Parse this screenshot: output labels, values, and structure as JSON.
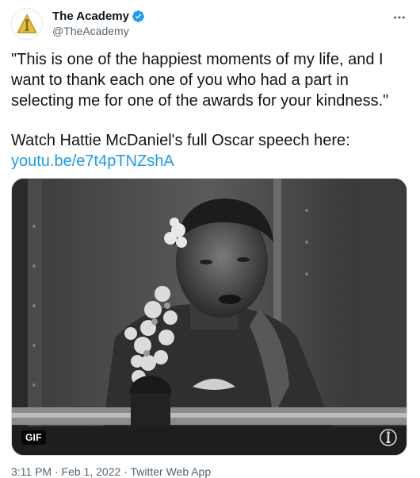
{
  "tweet": {
    "display_name": "The Academy",
    "handle": "@TheAcademy",
    "verified": true,
    "text_line1": "\"This is one of the happiest moments of my life, and I want to thank each one of you who had a part in selecting me for one of the awards for your kindness.\"",
    "text_line2": "Watch Hattie McDaniel's full Oscar speech here:",
    "link": "youtu.be/e7t4pTNZshA",
    "media_badge": "GIF",
    "timestamp": "3:11 PM · Feb 1, 2022 · Twitter Web App"
  },
  "icons": {
    "avatar": "oscar-statuette-icon",
    "verified": "verified-badge-icon",
    "more": "more-options-icon",
    "watermark": "oscar-statuette-icon"
  },
  "colors": {
    "link": "#1d9bf0",
    "verified": "#1d9bf0",
    "avatar_gold": "#c9a227"
  }
}
